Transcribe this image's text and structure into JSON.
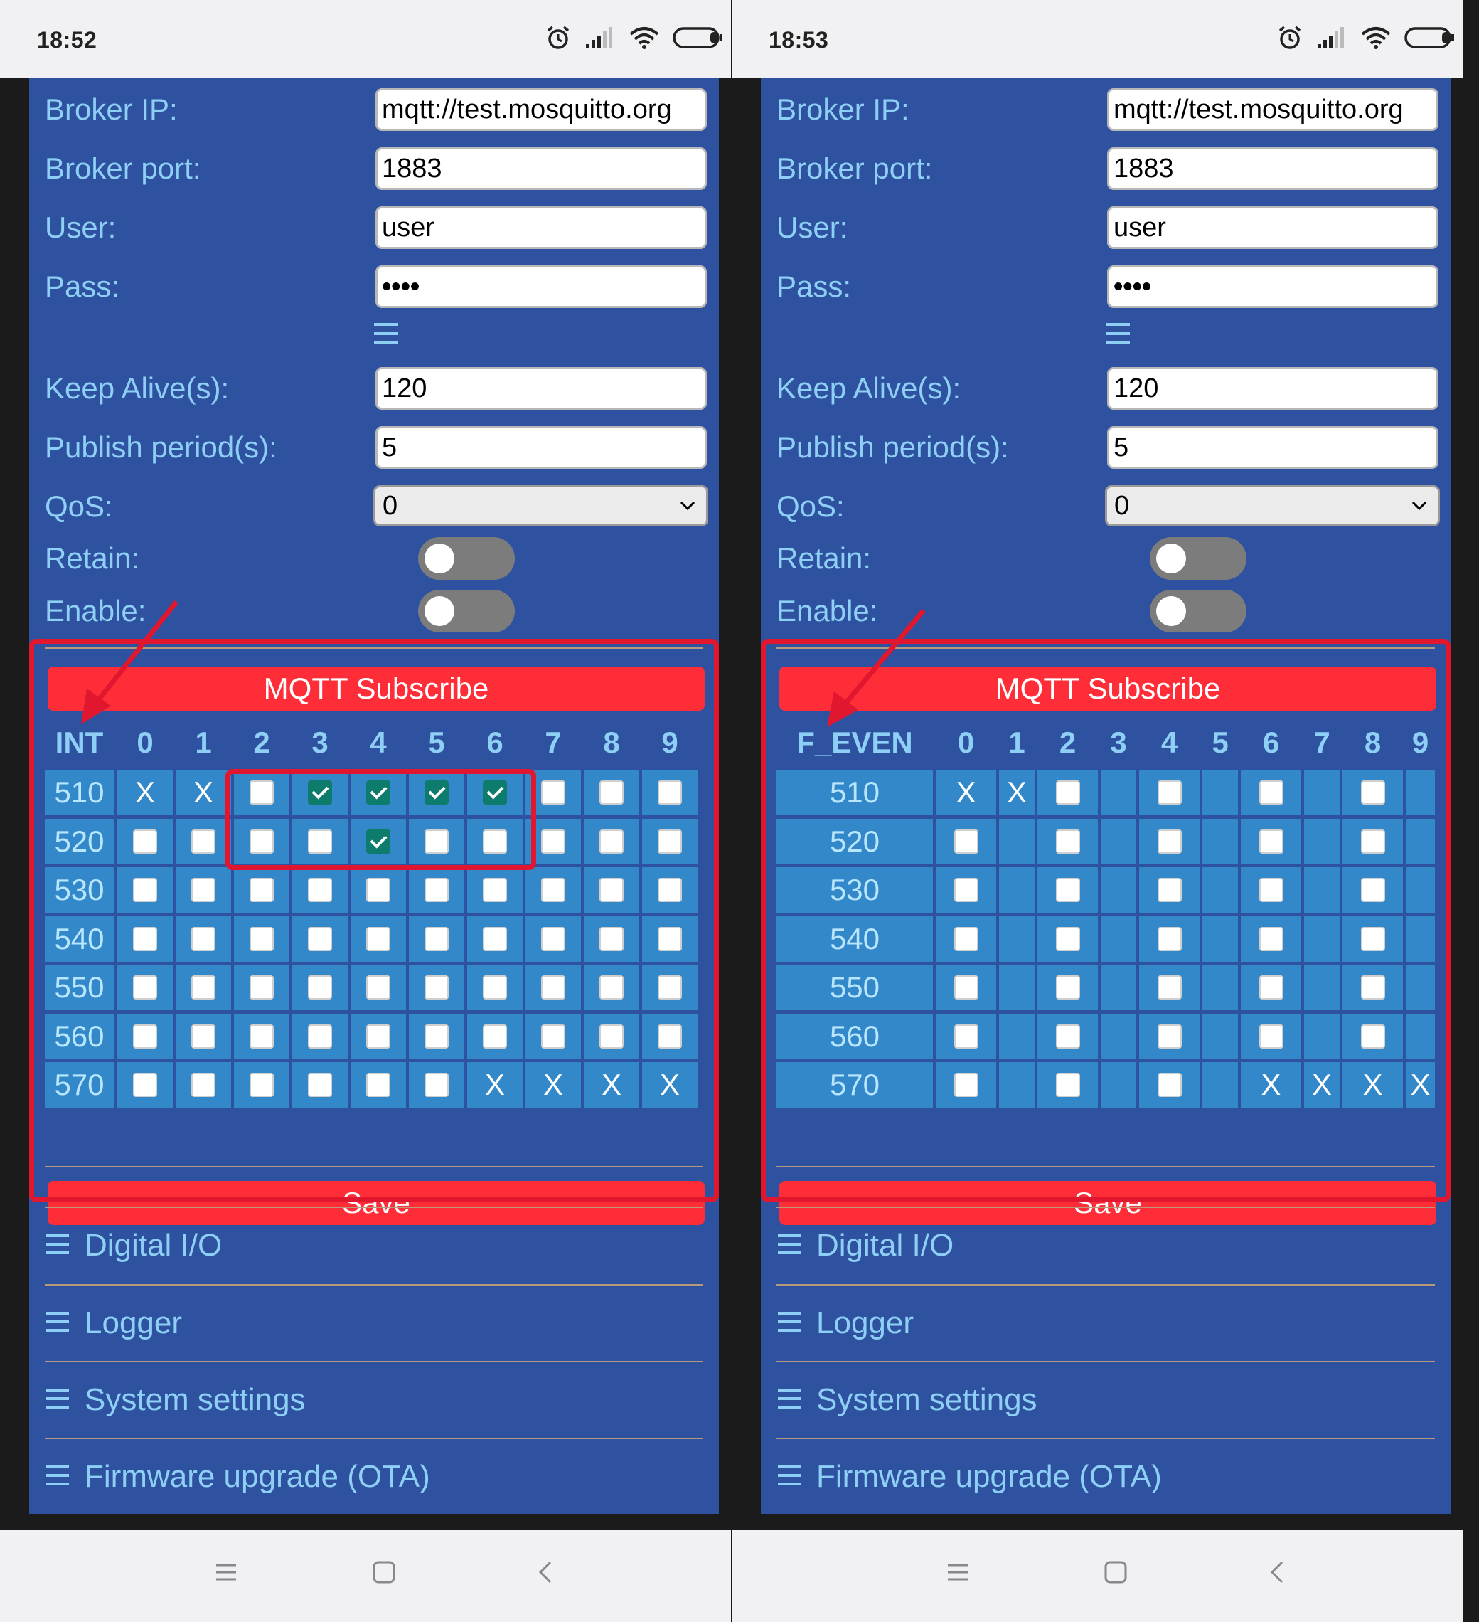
{
  "screens": [
    {
      "status": {
        "time": "18:52"
      },
      "form": {
        "broker_ip_label": "Broker IP:",
        "broker_ip_value": "mqtt://test.mosquitto.org",
        "broker_port_label": "Broker port:",
        "broker_port_value": "1883",
        "user_label": "User:",
        "user_value": "user",
        "pass_label": "Pass:",
        "pass_value": "••••",
        "keep_alive_label": "Keep Alive(s):",
        "keep_alive_value": "120",
        "publish_period_label": "Publish period(s):",
        "publish_period_value": "5",
        "qos_label": "QoS:",
        "qos_value": "0",
        "retain_label": "Retain:",
        "retain_on": false,
        "enable_label": "Enable:",
        "enable_on": false
      },
      "subscribe": {
        "title": "MQTT Subscribe",
        "corner_header": "INT",
        "column_headers": [
          "0",
          "1",
          "2",
          "3",
          "4",
          "5",
          "6",
          "7",
          "8",
          "9"
        ],
        "row_labels": [
          "510",
          "520",
          "530",
          "540",
          "550",
          "560",
          "570"
        ],
        "cells": [
          [
            "X",
            "X",
            "box",
            "check",
            "check",
            "check",
            "check",
            "box",
            "box",
            "box"
          ],
          [
            "box",
            "box",
            "box",
            "box",
            "check",
            "box",
            "box",
            "box",
            "box",
            "box"
          ],
          [
            "box",
            "box",
            "box",
            "box",
            "box",
            "box",
            "box",
            "box",
            "box",
            "box"
          ],
          [
            "box",
            "box",
            "box",
            "box",
            "box",
            "box",
            "box",
            "box",
            "box",
            "box"
          ],
          [
            "box",
            "box",
            "box",
            "box",
            "box",
            "box",
            "box",
            "box",
            "box",
            "box"
          ],
          [
            "box",
            "box",
            "box",
            "box",
            "box",
            "box",
            "box",
            "box",
            "box",
            "box"
          ],
          [
            "box",
            "box",
            "box",
            "box",
            "box",
            "box",
            "X",
            "X",
            "X",
            "X"
          ]
        ],
        "save_label": "Save"
      },
      "accordion": [
        "Digital I/O",
        "Logger",
        "System settings",
        "Firmware upgrade (OTA)"
      ]
    },
    {
      "status": {
        "time": "18:53"
      },
      "form": {
        "broker_ip_label": "Broker IP:",
        "broker_ip_value": "mqtt://test.mosquitto.org",
        "broker_port_label": "Broker port:",
        "broker_port_value": "1883",
        "user_label": "User:",
        "user_value": "user",
        "pass_label": "Pass:",
        "pass_value": "••••",
        "keep_alive_label": "Keep Alive(s):",
        "keep_alive_value": "120",
        "publish_period_label": "Publish period(s):",
        "publish_period_value": "5",
        "qos_label": "QoS:",
        "qos_value": "0",
        "retain_label": "Retain:",
        "retain_on": false,
        "enable_label": "Enable:",
        "enable_on": false
      },
      "subscribe": {
        "title": "MQTT Subscribe",
        "corner_header": "F_EVEN",
        "column_headers": [
          "0",
          "1",
          "2",
          "3",
          "4",
          "5",
          "6",
          "7",
          "8",
          "9"
        ],
        "row_labels": [
          "510",
          "520",
          "530",
          "540",
          "550",
          "560",
          "570"
        ],
        "cells": [
          [
            "X",
            "X",
            "box",
            "",
            "box",
            "",
            "box",
            "",
            "box",
            ""
          ],
          [
            "box",
            "",
            "box",
            "",
            "box",
            "",
            "box",
            "",
            "box",
            ""
          ],
          [
            "box",
            "",
            "box",
            "",
            "box",
            "",
            "box",
            "",
            "box",
            ""
          ],
          [
            "box",
            "",
            "box",
            "",
            "box",
            "",
            "box",
            "",
            "box",
            ""
          ],
          [
            "box",
            "",
            "box",
            "",
            "box",
            "",
            "box",
            "",
            "box",
            ""
          ],
          [
            "box",
            "",
            "box",
            "",
            "box",
            "",
            "box",
            "",
            "box",
            ""
          ],
          [
            "box",
            "",
            "box",
            "",
            "box",
            "",
            "X",
            "X",
            "X",
            "X"
          ]
        ],
        "save_label": "Save"
      },
      "accordion": [
        "Digital I/O",
        "Logger",
        "System settings",
        "Firmware upgrade (OTA)"
      ]
    }
  ],
  "colors": {
    "panel_bg": "#2f52a0",
    "label_text": "#8ed0f5",
    "grid_cell": "#3288c8",
    "accent_red": "#ff2d37",
    "highlight_red": "#e0172e",
    "checked": "#0e7c6c"
  },
  "icons": [
    "alarm-icon",
    "signal-icon",
    "wifi-icon",
    "battery-icon",
    "menu-icon",
    "chevron-down-icon",
    "hamburger-icon",
    "nav-menu-icon",
    "nav-home-icon",
    "nav-back-icon"
  ]
}
